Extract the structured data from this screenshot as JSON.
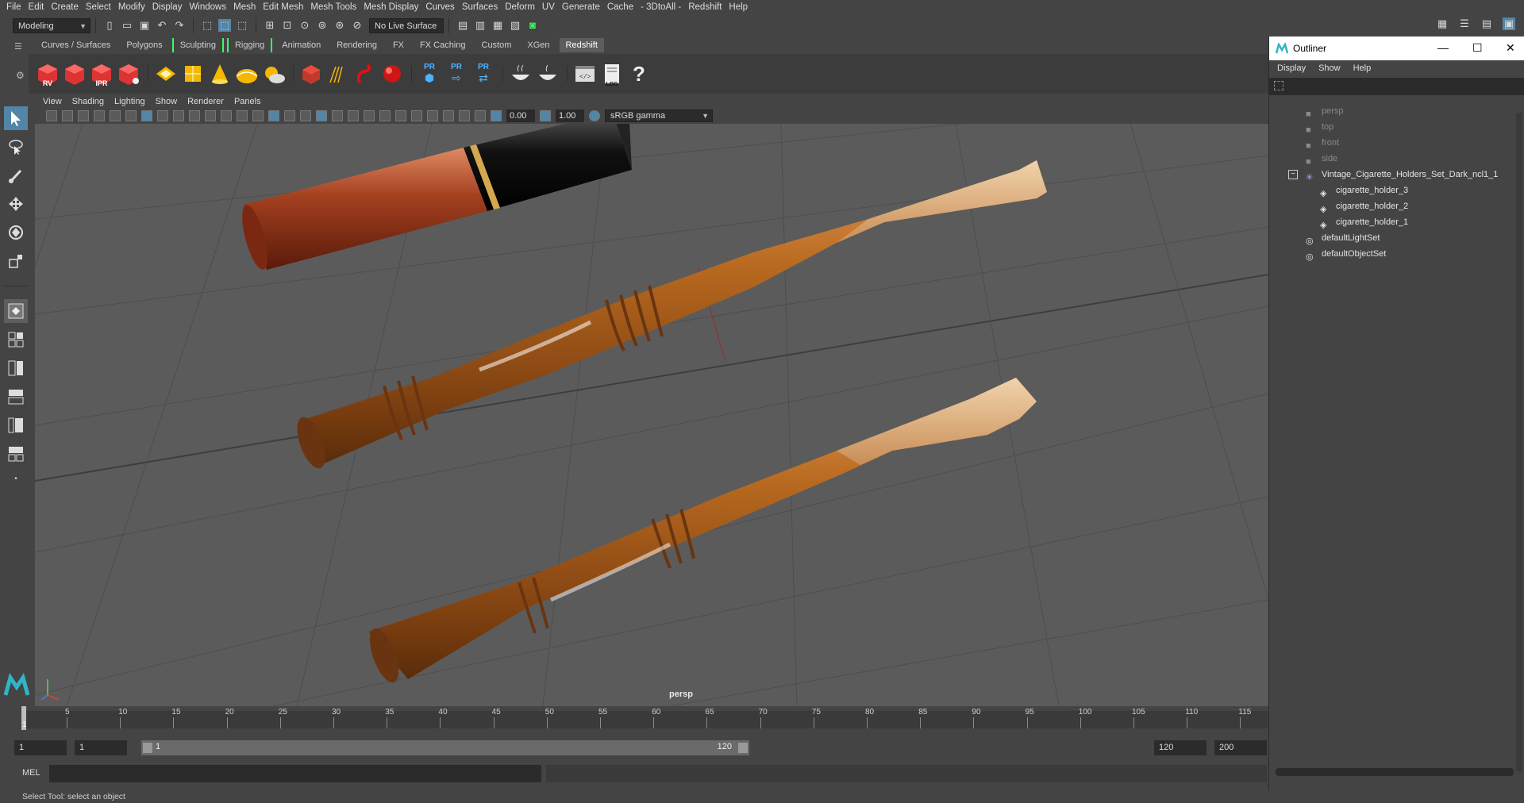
{
  "menubar": {
    "items": [
      "File",
      "Edit",
      "Create",
      "Select",
      "Modify",
      "Display",
      "Windows",
      "Mesh",
      "Edit Mesh",
      "Mesh Tools",
      "Mesh Display",
      "Curves",
      "Surfaces",
      "Deform",
      "UV",
      "Generate",
      "Cache",
      "- 3DtoAll -",
      "Redshift",
      "Help"
    ]
  },
  "statusline": {
    "mode": "Modeling",
    "live_surface": "No Live Surface"
  },
  "shelf_tabs": [
    "Curves / Surfaces",
    "Polygons",
    "Sculpting",
    "Rigging",
    "Animation",
    "Rendering",
    "FX",
    "FX Caching",
    "Custom",
    "XGen",
    "Redshift"
  ],
  "active_shelf_tab": "Redshift",
  "shelf": {
    "rv_label": "RV",
    "ipr_label": "IPR",
    "pr_label": "PR",
    "log_label": "LOG",
    "help_glyph": "?"
  },
  "panel_menu": [
    "View",
    "Shading",
    "Lighting",
    "Show",
    "Renderer",
    "Panels"
  ],
  "panel_toolbar": {
    "exposure": "0.00",
    "gamma": "1.00",
    "color_space": "sRGB gamma"
  },
  "viewport": {
    "camera_label": "persp"
  },
  "timeline": {
    "ticks": [
      "5",
      "10",
      "15",
      "20",
      "25",
      "30",
      "35",
      "40",
      "45",
      "50",
      "55",
      "60",
      "65",
      "70",
      "75",
      "80",
      "85",
      "90",
      "95",
      "100",
      "105",
      "110",
      "115"
    ],
    "current_frame": "1"
  },
  "range": {
    "start": "1",
    "playback_start": "1",
    "slider_start": "1",
    "slider_end": "120",
    "playback_end": "120",
    "end": "200"
  },
  "mel": {
    "label": "MEL"
  },
  "helpline": {
    "text": "Select Tool: select an object"
  },
  "outliner": {
    "title": "Outliner",
    "menu": [
      "Display",
      "Show",
      "Help"
    ],
    "items": [
      {
        "label": "persp",
        "dim": true
      },
      {
        "label": "top",
        "dim": true
      },
      {
        "label": "front",
        "dim": true
      },
      {
        "label": "side",
        "dim": true
      },
      {
        "label": "Vintage_Cigarette_Holders_Set_Dark_ncl1_1",
        "dim": false
      },
      {
        "label": "cigarette_holder_3",
        "dim": false
      },
      {
        "label": "cigarette_holder_2",
        "dim": false
      },
      {
        "label": "cigarette_holder_1",
        "dim": false
      },
      {
        "label": "defaultLightSet",
        "dim": false
      },
      {
        "label": "defaultObjectSet",
        "dim": false
      }
    ]
  },
  "colors": {
    "accent": "#5285a6",
    "viewport_bg": "#5b5b5b",
    "wood": "#b8691f",
    "redwood": "#a3401f"
  }
}
